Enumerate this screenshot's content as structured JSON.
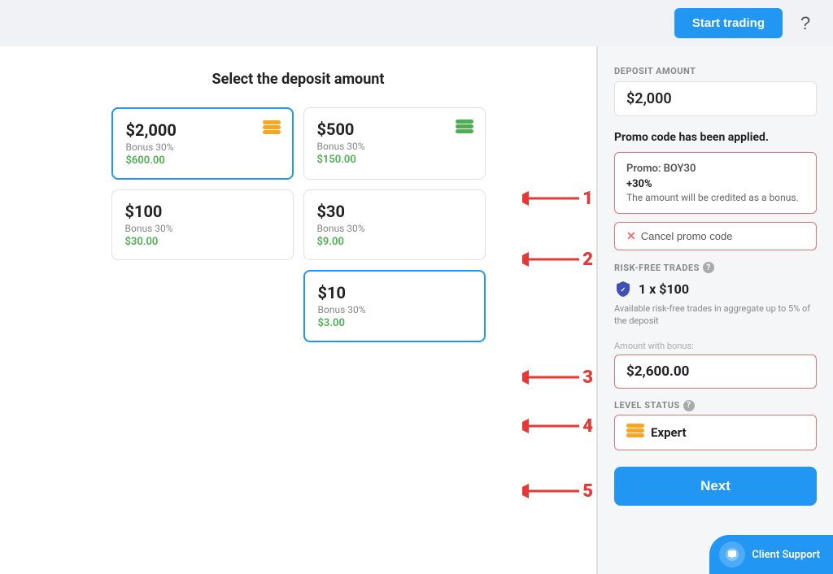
{
  "topBar": {
    "startTradingLabel": "Start trading",
    "helpIcon": "?"
  },
  "leftPanel": {
    "title": "Select the deposit amount",
    "cards": [
      {
        "amount": "$2,000",
        "bonusLabel": "Bonus 30%",
        "bonusValue": "$600.00",
        "selected": true,
        "iconType": "stack-gold"
      },
      {
        "amount": "$500",
        "bonusLabel": "Bonus 30%",
        "bonusValue": "$150.00",
        "selected": false,
        "iconType": "stack-green"
      },
      {
        "amount": "$100",
        "bonusLabel": "Bonus 30%",
        "bonusValue": "$30.00",
        "selected": false,
        "iconType": "none"
      },
      {
        "amount": "$30",
        "bonusLabel": "Bonus 30%",
        "bonusValue": "$9.00",
        "selected": false,
        "iconType": "none"
      },
      {
        "amount": "$10",
        "bonusLabel": "Bonus 30%",
        "bonusValue": "$3.00",
        "selected": true,
        "iconType": "none"
      }
    ]
  },
  "rightPanel": {
    "depositAmountLabel": "DEPOSIT AMOUNT",
    "depositAmountValue": "$2,000",
    "promoAppliedText": "Promo code has been applied.",
    "promoBox": {
      "codeLine": "Promo: BOY30",
      "percent": "+30%",
      "description": "The amount will be credited as a bonus."
    },
    "cancelPromoLabel": "Cancel promo code",
    "riskFreeLabel": "RISK-FREE TRADES",
    "riskFreeAmount": "1 x $100",
    "riskFreeNote": "Available risk-free trades in aggregate up to 5% of the deposit",
    "amountWithBonusLabel": "Amount with bonus:",
    "amountWithBonusValue": "$2,600.00",
    "levelStatusLabel": "LEVEL STATUS",
    "levelName": "Expert",
    "nextButtonLabel": "Next"
  },
  "clientSupport": {
    "label": "Client Support"
  },
  "annotations": {
    "arrow1": "1",
    "arrow2": "2",
    "arrow3": "3",
    "arrow4": "4",
    "arrow5": "5"
  }
}
